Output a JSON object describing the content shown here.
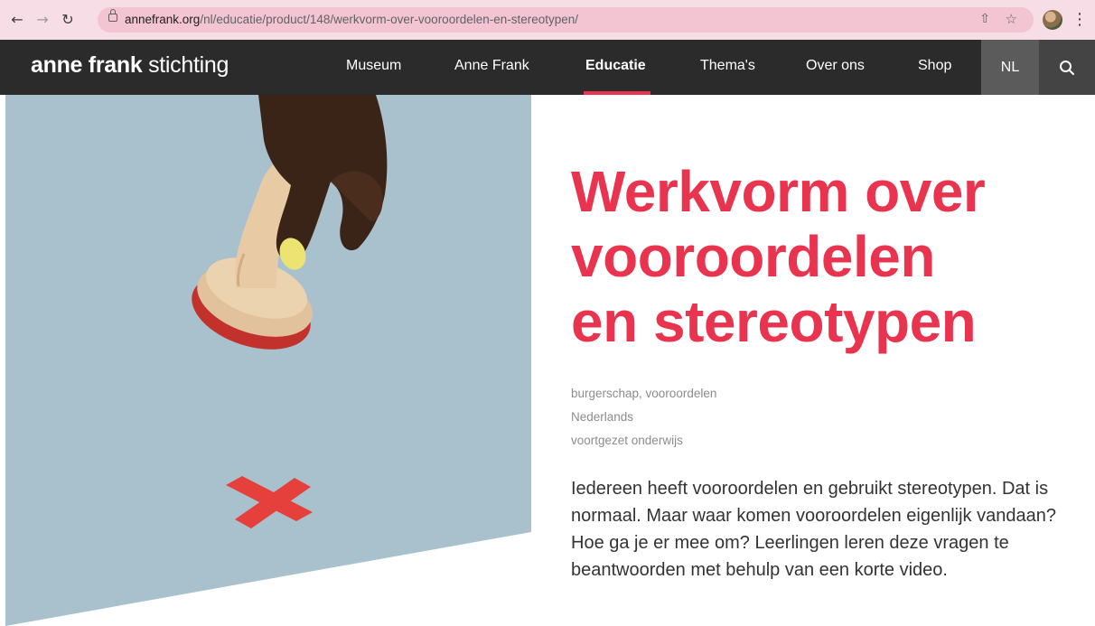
{
  "browser": {
    "url_domain": "annefrank.org",
    "url_path": "/nl/educatie/product/148/werkvorm-over-vooroordelen-en-stereotypen/",
    "icons": [
      "back-arrow-icon",
      "forward-arrow-icon",
      "reload-icon",
      "lock-icon",
      "share-icon",
      "bookmark-star-icon",
      "profile-avatar",
      "kebab-menu-icon"
    ]
  },
  "header": {
    "logo_bold": "anne frank",
    "logo_light": " stichting",
    "nav": [
      {
        "label": "Museum"
      },
      {
        "label": "Anne Frank"
      },
      {
        "label": "Educatie",
        "active": true
      },
      {
        "label": "Thema's"
      },
      {
        "label": "Over ons"
      },
      {
        "label": "Shop"
      }
    ],
    "language": "NL",
    "search_icon": "search-icon"
  },
  "hero": {
    "title_lines": [
      "Werkvorm over",
      "vooroordelen",
      "en stereotypen"
    ],
    "tags": [
      "burgerschap,  vooroordelen",
      "Nederlands",
      "voortgezet onderwijs"
    ],
    "intro": "Iedereen heeft vooroordelen en gebruikt stereotypen. Dat is normaal. Maar waar komen vooroordelen eigenlijk vandaan? Hoe ga je er mee om? Leerlingen leren deze vragen te beantwoorden met behulp van een korte video."
  },
  "colors": {
    "accent": "#e8344e",
    "header_bg": "#2b2b2b",
    "chrome_bg": "#f7dde5",
    "omnibox_bg": "#f3c4d2",
    "image_bg": "#a9c1cd"
  }
}
